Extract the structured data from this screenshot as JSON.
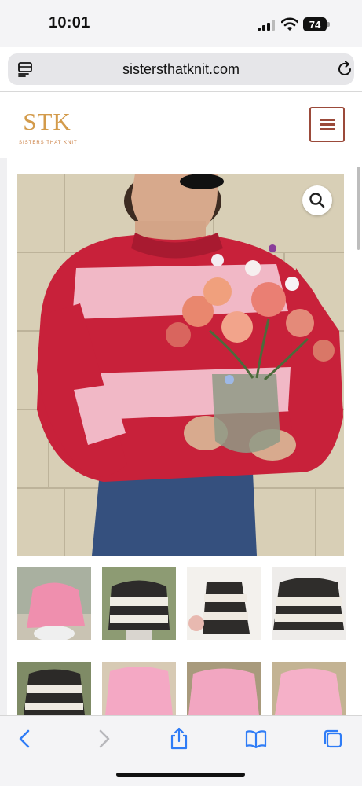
{
  "status_bar": {
    "time": "10:01",
    "battery": "74"
  },
  "browser": {
    "url": "sistersthatknit.com"
  },
  "site": {
    "logo_mark": "STK",
    "logo_tagline": "SISTERS THAT KNIT",
    "colors": {
      "brand_gold": "#d39b4b",
      "brand_rust": "#9b4a3a"
    }
  },
  "product_gallery": {
    "thumbnails": [
      {
        "icon": "pink-sweater-photo"
      },
      {
        "icon": "black-white-striped-sweater-photo"
      },
      {
        "icon": "black-white-striped-sweater-flatlay"
      },
      {
        "icon": "black-white-striped-sweater-hanger"
      },
      {
        "icon": "black-white-striped-sweater-photo-2"
      },
      {
        "icon": "pink-sweater-photo-2"
      },
      {
        "icon": "pink-sweater-photo-3"
      },
      {
        "icon": "pink-sweater-photo-4"
      }
    ]
  },
  "toolbar": {
    "icons": [
      "back-icon",
      "forward-icon",
      "share-icon",
      "bookmarks-icon",
      "tabs-icon"
    ]
  }
}
